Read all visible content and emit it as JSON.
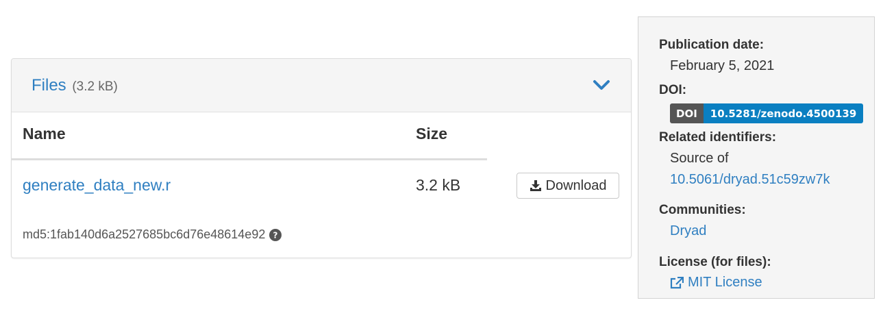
{
  "files": {
    "title": "Files",
    "total_size": "(3.2 kB)",
    "columns": {
      "name": "Name",
      "size": "Size"
    },
    "rows": [
      {
        "filename": "generate_data_new.r",
        "size": "3.2 kB",
        "download_label": "Download",
        "md5": "md5:1fab140d6a2527685bc6d76e48614e92"
      }
    ]
  },
  "sidebar": {
    "publication_date_label": "Publication date:",
    "publication_date": "February 5, 2021",
    "doi_label": "DOI:",
    "doi_badge_prefix": "DOI",
    "doi_value": "10.5281/zenodo.4500139",
    "related_label": "Related identifiers:",
    "related_text": "Source of",
    "related_link": "10.5061/dryad.51c59zw7k",
    "communities_label": "Communities:",
    "community": "Dryad",
    "license_label": "License (for files):",
    "license": "MIT License"
  },
  "colors": {
    "link": "#2f7fc1",
    "doi_badge_left": "#555555",
    "doi_badge_right": "#0a7fc1"
  },
  "icons": [
    "chevron-down-icon",
    "download-icon",
    "question-circle-icon",
    "external-link-icon"
  ]
}
